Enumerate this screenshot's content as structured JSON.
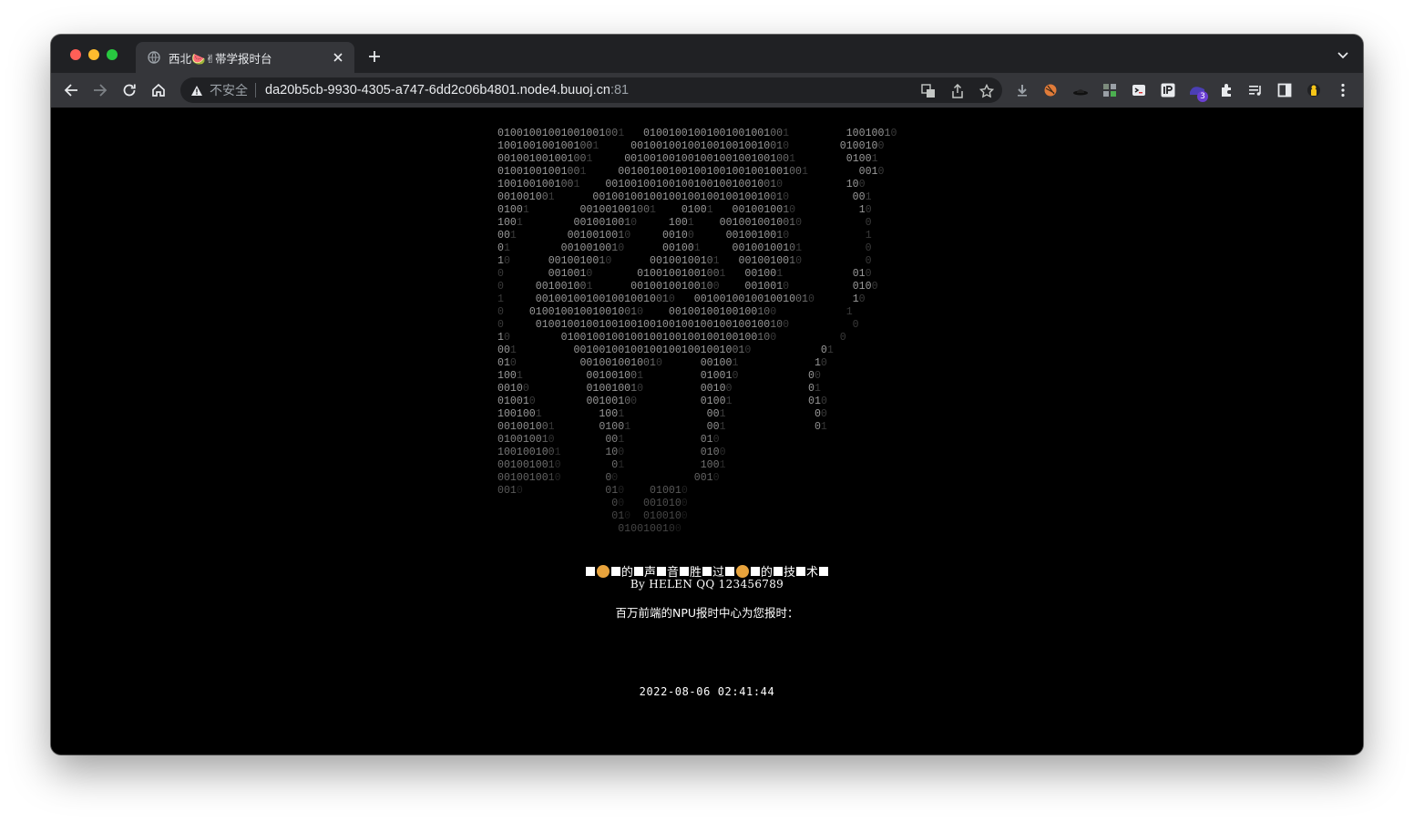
{
  "browser": {
    "tab": {
      "title": "西北🍉✌帯学报时台",
      "favicon": "globe-icon"
    },
    "omnibox": {
      "security_label": "不安全",
      "url_main": "da20b5cb-9930-4305-a747-6dd2c06b4801.node4.buuoj.cn",
      "url_port": ":81"
    },
    "extension_badge": "3"
  },
  "page": {
    "ascii_art": [
      "01001001001001001001   01001001001001001001001         10010010",
      "1001001001001001     0010010010010010010010010        0100100",
      "001001001001001     001001001001001001001001001        01001",
      "01001001001001     001001001001001001001001001001        0010",
      "1001001001001    0010010010010010010010010010          100",
      "001001001      0010010010010010010010010010010          001",
      "01001        001001001001    01001   0010010010          10",
      "1001        0010010010     1001    0010010010010          0",
      "001        0010010010     00100     0010010010            1",
      "01        0010010010      001001     00100100101          0",
      "10      0010010010      00100100101   0010010010          0",
      "0       0010010       01001001001001   001001           010",
      "0     001001001      00100100100100    0010010          0100",
      "1     0010010010010010010010   0010010010010010010      10",
      "0    010010010010010010    00100100100100100           1",
      "0     0100100100100100100100100100100100100100          0",
      "10        0100100100100100100100100100100100          0",
      "001         0010010010010010010010010010           01",
      "010          0010010010010      001001            10",
      "1001          001001001         010010           00",
      "00100         010010010         00100            01",
      "010010        00100100          01001            010",
      "1001001         1001             001              00",
      "001001001       01001            001              01",
      "010010010        001            010",
      "1001001001       100            0100",
      "0010010010        01            1001",
      "0010010010       00            0010",
      "0010             010    010010",
      "                  00   0010100",
      "                  010  0100100",
      "                   0100100100"
    ],
    "headline_text": [
      "的",
      "声",
      "音",
      "胜",
      "过",
      "的",
      "技",
      "术"
    ],
    "byline": "By  HELEN  QQ 123456789",
    "report_label": "百万前端的NPU报时中心为您报时：",
    "datetime": "2022-08-06 02:41:44"
  }
}
